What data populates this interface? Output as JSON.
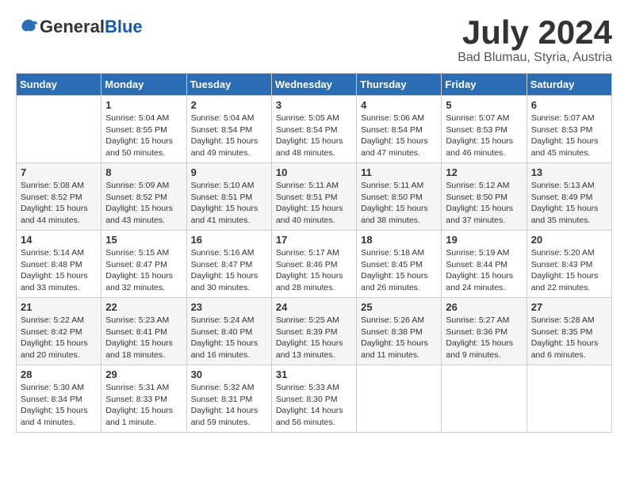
{
  "header": {
    "logo_line1": "General",
    "logo_line2": "Blue",
    "month_title": "July 2024",
    "location": "Bad Blumau, Styria, Austria"
  },
  "calendar": {
    "days_of_week": [
      "Sunday",
      "Monday",
      "Tuesday",
      "Wednesday",
      "Thursday",
      "Friday",
      "Saturday"
    ],
    "weeks": [
      [
        {
          "day": "",
          "info": ""
        },
        {
          "day": "1",
          "info": "Sunrise: 5:04 AM\nSunset: 8:55 PM\nDaylight: 15 hours\nand 50 minutes."
        },
        {
          "day": "2",
          "info": "Sunrise: 5:04 AM\nSunset: 8:54 PM\nDaylight: 15 hours\nand 49 minutes."
        },
        {
          "day": "3",
          "info": "Sunrise: 5:05 AM\nSunset: 8:54 PM\nDaylight: 15 hours\nand 48 minutes."
        },
        {
          "day": "4",
          "info": "Sunrise: 5:06 AM\nSunset: 8:54 PM\nDaylight: 15 hours\nand 47 minutes."
        },
        {
          "day": "5",
          "info": "Sunrise: 5:07 AM\nSunset: 8:53 PM\nDaylight: 15 hours\nand 46 minutes."
        },
        {
          "day": "6",
          "info": "Sunrise: 5:07 AM\nSunset: 8:53 PM\nDaylight: 15 hours\nand 45 minutes."
        }
      ],
      [
        {
          "day": "7",
          "info": "Sunrise: 5:08 AM\nSunset: 8:52 PM\nDaylight: 15 hours\nand 44 minutes."
        },
        {
          "day": "8",
          "info": "Sunrise: 5:09 AM\nSunset: 8:52 PM\nDaylight: 15 hours\nand 43 minutes."
        },
        {
          "day": "9",
          "info": "Sunrise: 5:10 AM\nSunset: 8:51 PM\nDaylight: 15 hours\nand 41 minutes."
        },
        {
          "day": "10",
          "info": "Sunrise: 5:11 AM\nSunset: 8:51 PM\nDaylight: 15 hours\nand 40 minutes."
        },
        {
          "day": "11",
          "info": "Sunrise: 5:11 AM\nSunset: 8:50 PM\nDaylight: 15 hours\nand 38 minutes."
        },
        {
          "day": "12",
          "info": "Sunrise: 5:12 AM\nSunset: 8:50 PM\nDaylight: 15 hours\nand 37 minutes."
        },
        {
          "day": "13",
          "info": "Sunrise: 5:13 AM\nSunset: 8:49 PM\nDaylight: 15 hours\nand 35 minutes."
        }
      ],
      [
        {
          "day": "14",
          "info": "Sunrise: 5:14 AM\nSunset: 8:48 PM\nDaylight: 15 hours\nand 33 minutes."
        },
        {
          "day": "15",
          "info": "Sunrise: 5:15 AM\nSunset: 8:47 PM\nDaylight: 15 hours\nand 32 minutes."
        },
        {
          "day": "16",
          "info": "Sunrise: 5:16 AM\nSunset: 8:47 PM\nDaylight: 15 hours\nand 30 minutes."
        },
        {
          "day": "17",
          "info": "Sunrise: 5:17 AM\nSunset: 8:46 PM\nDaylight: 15 hours\nand 28 minutes."
        },
        {
          "day": "18",
          "info": "Sunrise: 5:18 AM\nSunset: 8:45 PM\nDaylight: 15 hours\nand 26 minutes."
        },
        {
          "day": "19",
          "info": "Sunrise: 5:19 AM\nSunset: 8:44 PM\nDaylight: 15 hours\nand 24 minutes."
        },
        {
          "day": "20",
          "info": "Sunrise: 5:20 AM\nSunset: 8:43 PM\nDaylight: 15 hours\nand 22 minutes."
        }
      ],
      [
        {
          "day": "21",
          "info": "Sunrise: 5:22 AM\nSunset: 8:42 PM\nDaylight: 15 hours\nand 20 minutes."
        },
        {
          "day": "22",
          "info": "Sunrise: 5:23 AM\nSunset: 8:41 PM\nDaylight: 15 hours\nand 18 minutes."
        },
        {
          "day": "23",
          "info": "Sunrise: 5:24 AM\nSunset: 8:40 PM\nDaylight: 15 hours\nand 16 minutes."
        },
        {
          "day": "24",
          "info": "Sunrise: 5:25 AM\nSunset: 8:39 PM\nDaylight: 15 hours\nand 13 minutes."
        },
        {
          "day": "25",
          "info": "Sunrise: 5:26 AM\nSunset: 8:38 PM\nDaylight: 15 hours\nand 11 minutes."
        },
        {
          "day": "26",
          "info": "Sunrise: 5:27 AM\nSunset: 8:36 PM\nDaylight: 15 hours\nand 9 minutes."
        },
        {
          "day": "27",
          "info": "Sunrise: 5:28 AM\nSunset: 8:35 PM\nDaylight: 15 hours\nand 6 minutes."
        }
      ],
      [
        {
          "day": "28",
          "info": "Sunrise: 5:30 AM\nSunset: 8:34 PM\nDaylight: 15 hours\nand 4 minutes."
        },
        {
          "day": "29",
          "info": "Sunrise: 5:31 AM\nSunset: 8:33 PM\nDaylight: 15 hours\nand 1 minute."
        },
        {
          "day": "30",
          "info": "Sunrise: 5:32 AM\nSunset: 8:31 PM\nDaylight: 14 hours\nand 59 minutes."
        },
        {
          "day": "31",
          "info": "Sunrise: 5:33 AM\nSunset: 8:30 PM\nDaylight: 14 hours\nand 56 minutes."
        },
        {
          "day": "",
          "info": ""
        },
        {
          "day": "",
          "info": ""
        },
        {
          "day": "",
          "info": ""
        }
      ]
    ]
  }
}
